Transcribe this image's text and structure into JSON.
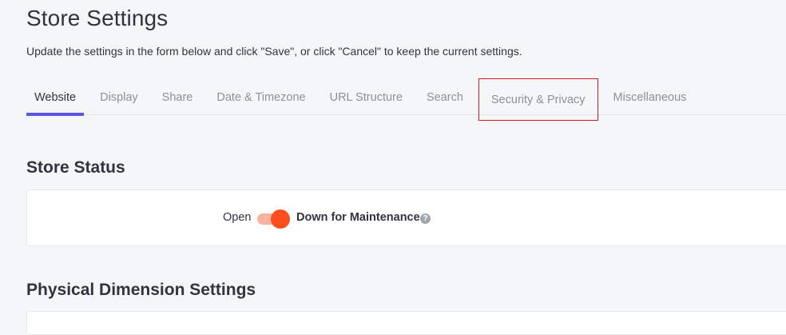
{
  "header": {
    "title": "Store Settings",
    "subtitle": "Update the settings in the form below and click \"Save\", or click \"Cancel\" to keep the current settings."
  },
  "tabs": [
    {
      "label": "Website",
      "active": true
    },
    {
      "label": "Display",
      "active": false
    },
    {
      "label": "Share",
      "active": false
    },
    {
      "label": "Date & Timezone",
      "active": false
    },
    {
      "label": "URL Structure",
      "active": false
    },
    {
      "label": "Search",
      "active": false
    },
    {
      "label": "Security & Privacy",
      "active": false,
      "highlighted": true
    },
    {
      "label": "Miscellaneous",
      "active": false
    }
  ],
  "store_status": {
    "title": "Store Status",
    "open_label": "Open",
    "down_label": "Down for Maintenance",
    "toggle_on": true,
    "help_icon": "question-mark-icon",
    "help_glyph": "?"
  },
  "physical_dimension": {
    "title": "Physical Dimension Settings"
  },
  "colors": {
    "accent": "#5b57e0",
    "toggle_knob": "#ff4e1e",
    "toggle_track": "#f8b3a0",
    "highlight_box": "#cc1f1f"
  }
}
